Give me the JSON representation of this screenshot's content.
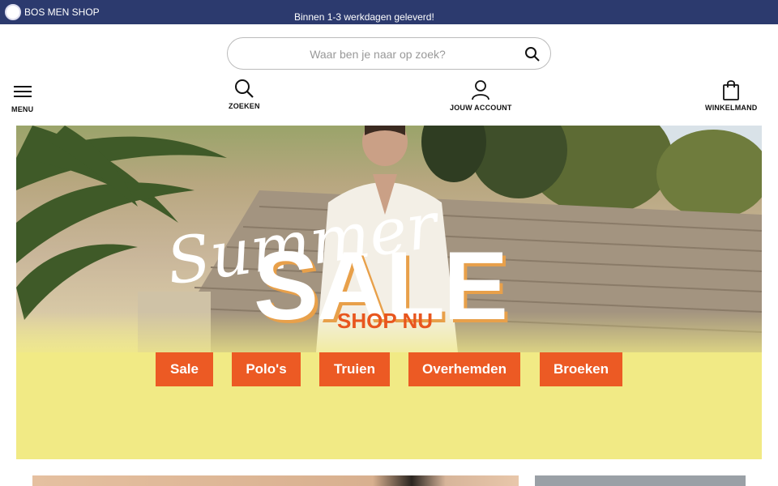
{
  "topbar": {
    "logo_text": "BOS MEN SHOP",
    "message": "Binnen 1-3 werkdagen geleverd!"
  },
  "search": {
    "placeholder": "Waar ben je naar op zoek?",
    "value": ""
  },
  "nav": {
    "menu": "MENU",
    "search": "ZOEKEN",
    "account": "JOUW ACCOUNT",
    "cart": "WINKELMAND"
  },
  "hero": {
    "script_text": "Summer",
    "headline": "SALE",
    "cta": "SHOP NU",
    "categories": [
      "Sale",
      "Polo's",
      "Truien",
      "Overhemden",
      "Broeken"
    ]
  },
  "colors": {
    "topbar": "#2c3a6e",
    "accent": "#ec5a24",
    "hero_yellow": "#f1ea85"
  }
}
